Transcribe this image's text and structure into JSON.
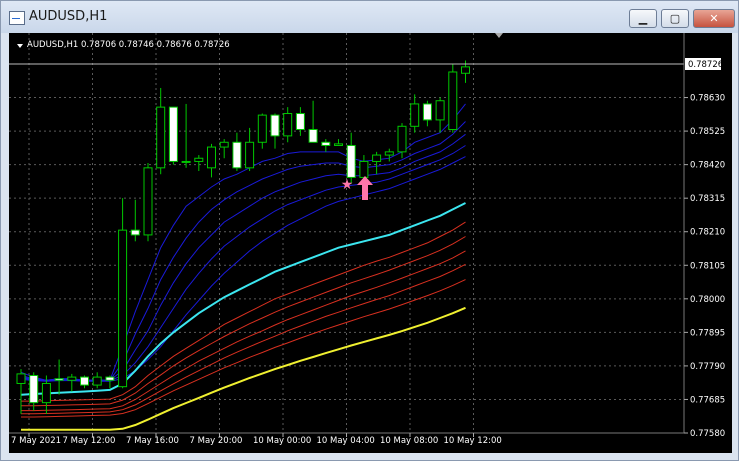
{
  "window": {
    "title": "AUDUSD,H1"
  },
  "controls": {
    "minimize": "▁",
    "maximize": "▢",
    "close": "✕"
  },
  "symbol_info": "AUDUSD,H1  0.78706 0.78746 0.78676 0.78726",
  "current_price": "0.78726",
  "colors": {
    "background": "#000000",
    "grid": "#5a5a5a",
    "candle_up": "#ffffff",
    "candle_down": "#000000",
    "candle_outline": "#00c800",
    "blue_ma": "#1a1ad8",
    "cyan_ma": "#3ce6f0",
    "red_ma": "#d83020",
    "yellow_ma": "#f0f030",
    "arrow": "#ff77aa",
    "star": "#ff77aa"
  },
  "chart_data": {
    "type": "candlestick",
    "ylim": [
      0.7758,
      0.78735
    ],
    "y_ticks": [
      "0.78630",
      "0.78525",
      "0.78420",
      "0.78315",
      "0.78210",
      "0.78105",
      "0.78000",
      "0.77895",
      "0.77790",
      "0.77685",
      "0.77580"
    ],
    "x_labels": [
      "7 May 2021",
      "7 May 12:00",
      "7 May 16:00",
      "7 May 20:00",
      "10 May 00:00",
      "10 May 04:00",
      "10 May 08:00",
      "10 May 12:00"
    ],
    "candles": [
      {
        "o": 0.77735,
        "h": 0.7778,
        "l": 0.7764,
        "c": 0.77765
      },
      {
        "o": 0.7776,
        "h": 0.7777,
        "l": 0.7765,
        "c": 0.77675
      },
      {
        "o": 0.77675,
        "h": 0.7776,
        "l": 0.7764,
        "c": 0.77735
      },
      {
        "o": 0.7775,
        "h": 0.7781,
        "l": 0.777,
        "c": 0.77745
      },
      {
        "o": 0.77745,
        "h": 0.77765,
        "l": 0.7771,
        "c": 0.77755
      },
      {
        "o": 0.77755,
        "h": 0.7776,
        "l": 0.7772,
        "c": 0.7773
      },
      {
        "o": 0.7773,
        "h": 0.7777,
        "l": 0.7772,
        "c": 0.77755
      },
      {
        "o": 0.77755,
        "h": 0.7776,
        "l": 0.7772,
        "c": 0.77745
      },
      {
        "o": 0.77725,
        "h": 0.78315,
        "l": 0.7772,
        "c": 0.78215
      },
      {
        "o": 0.78215,
        "h": 0.7831,
        "l": 0.7818,
        "c": 0.782
      },
      {
        "o": 0.782,
        "h": 0.78425,
        "l": 0.7818,
        "c": 0.7841
      },
      {
        "o": 0.7841,
        "h": 0.7866,
        "l": 0.7839,
        "c": 0.786
      },
      {
        "o": 0.786,
        "h": 0.786,
        "l": 0.7842,
        "c": 0.7843
      },
      {
        "o": 0.7843,
        "h": 0.7861,
        "l": 0.7841,
        "c": 0.7843
      },
      {
        "o": 0.7843,
        "h": 0.7845,
        "l": 0.784,
        "c": 0.7844
      },
      {
        "o": 0.7841,
        "h": 0.78485,
        "l": 0.7838,
        "c": 0.78475
      },
      {
        "o": 0.78475,
        "h": 0.785,
        "l": 0.7844,
        "c": 0.7849
      },
      {
        "o": 0.7849,
        "h": 0.7852,
        "l": 0.784,
        "c": 0.7841
      },
      {
        "o": 0.7841,
        "h": 0.78535,
        "l": 0.784,
        "c": 0.7849
      },
      {
        "o": 0.7849,
        "h": 0.7858,
        "l": 0.7847,
        "c": 0.78575
      },
      {
        "o": 0.78575,
        "h": 0.7858,
        "l": 0.7847,
        "c": 0.7851
      },
      {
        "o": 0.7851,
        "h": 0.786,
        "l": 0.7849,
        "c": 0.7858
      },
      {
        "o": 0.7858,
        "h": 0.786,
        "l": 0.7851,
        "c": 0.7853
      },
      {
        "o": 0.7853,
        "h": 0.7862,
        "l": 0.7849,
        "c": 0.7849
      },
      {
        "o": 0.7849,
        "h": 0.785,
        "l": 0.7846,
        "c": 0.7848
      },
      {
        "o": 0.7848,
        "h": 0.785,
        "l": 0.7848,
        "c": 0.78485
      },
      {
        "o": 0.7848,
        "h": 0.7852,
        "l": 0.7836,
        "c": 0.7838
      },
      {
        "o": 0.7838,
        "h": 0.7845,
        "l": 0.7837,
        "c": 0.7843
      },
      {
        "o": 0.7843,
        "h": 0.7846,
        "l": 0.7839,
        "c": 0.7845
      },
      {
        "o": 0.7845,
        "h": 0.7847,
        "l": 0.7843,
        "c": 0.7846
      },
      {
        "o": 0.7846,
        "h": 0.7855,
        "l": 0.7844,
        "c": 0.7854
      },
      {
        "o": 0.7854,
        "h": 0.7864,
        "l": 0.7852,
        "c": 0.7861
      },
      {
        "o": 0.7861,
        "h": 0.7862,
        "l": 0.7854,
        "c": 0.7856
      },
      {
        "o": 0.7856,
        "h": 0.7863,
        "l": 0.7852,
        "c": 0.7862
      },
      {
        "o": 0.7853,
        "h": 0.78735,
        "l": 0.7852,
        "c": 0.7871
      },
      {
        "o": 0.78706,
        "h": 0.78746,
        "l": 0.78676,
        "c": 0.78726
      }
    ],
    "ma_series": [
      {
        "color": "blue",
        "values": [
          0.7777,
          0.77755,
          0.77745,
          0.7775,
          0.7775,
          0.77745,
          0.77745,
          0.77745,
          0.7785,
          0.7796,
          0.7806,
          0.7816,
          0.7823,
          0.7829,
          0.7832,
          0.7835,
          0.78375,
          0.7839,
          0.7841,
          0.7843,
          0.7844,
          0.78455,
          0.7846,
          0.7846,
          0.7846,
          0.7846,
          0.7844,
          0.7843,
          0.78435,
          0.7844,
          0.7846,
          0.7849,
          0.78505,
          0.7852,
          0.7856,
          0.7861
        ]
      },
      {
        "color": "blue",
        "values": [
          0.7776,
          0.7775,
          0.77745,
          0.7775,
          0.7775,
          0.77745,
          0.77745,
          0.77745,
          0.778,
          0.7789,
          0.7797,
          0.7806,
          0.7813,
          0.7819,
          0.7824,
          0.7828,
          0.7831,
          0.78335,
          0.78355,
          0.78375,
          0.7839,
          0.78405,
          0.78415,
          0.7842,
          0.78425,
          0.78425,
          0.78415,
          0.7841,
          0.78415,
          0.7842,
          0.78435,
          0.78455,
          0.7847,
          0.78485,
          0.78515,
          0.78555
        ]
      },
      {
        "color": "blue",
        "values": [
          0.77755,
          0.77748,
          0.77745,
          0.77748,
          0.77748,
          0.77745,
          0.77745,
          0.77745,
          0.77775,
          0.7784,
          0.779,
          0.7798,
          0.7805,
          0.7811,
          0.7816,
          0.782,
          0.7824,
          0.78265,
          0.7829,
          0.78315,
          0.78335,
          0.7835,
          0.78365,
          0.78375,
          0.78385,
          0.7839,
          0.78385,
          0.78385,
          0.7839,
          0.78395,
          0.7841,
          0.7843,
          0.78445,
          0.7846,
          0.78485,
          0.78515
        ]
      },
      {
        "color": "blue",
        "values": [
          0.77752,
          0.77746,
          0.77744,
          0.77746,
          0.77746,
          0.77744,
          0.77744,
          0.77744,
          0.7776,
          0.778,
          0.7785,
          0.7791,
          0.7797,
          0.7803,
          0.7808,
          0.78125,
          0.78165,
          0.78195,
          0.78225,
          0.7825,
          0.78275,
          0.78295,
          0.7831,
          0.78325,
          0.7834,
          0.7835,
          0.78355,
          0.7836,
          0.78365,
          0.78375,
          0.7839,
          0.78405,
          0.7842,
          0.78435,
          0.78455,
          0.7848
        ]
      },
      {
        "color": "blue",
        "values": [
          0.77748,
          0.77744,
          0.77742,
          0.77744,
          0.77744,
          0.77742,
          0.77742,
          0.77742,
          0.7775,
          0.77775,
          0.7781,
          0.7785,
          0.779,
          0.7795,
          0.77995,
          0.7804,
          0.7808,
          0.78115,
          0.7815,
          0.7818,
          0.78205,
          0.7823,
          0.7825,
          0.7827,
          0.7829,
          0.78305,
          0.78315,
          0.78325,
          0.78335,
          0.78345,
          0.7836,
          0.78375,
          0.7839,
          0.78405,
          0.78425,
          0.78445
        ]
      },
      {
        "color": "cyan",
        "values": [
          0.777,
          0.77702,
          0.77704,
          0.77706,
          0.77708,
          0.7771,
          0.77712,
          0.77715,
          0.77735,
          0.77775,
          0.7782,
          0.7786,
          0.77895,
          0.77925,
          0.77955,
          0.7798,
          0.78005,
          0.78025,
          0.78045,
          0.78065,
          0.78085,
          0.781,
          0.78115,
          0.7813,
          0.78145,
          0.7816,
          0.7817,
          0.7818,
          0.7819,
          0.782,
          0.78215,
          0.7823,
          0.78245,
          0.7826,
          0.7828,
          0.783
        ]
      },
      {
        "color": "red",
        "values": [
          0.7768,
          0.7768,
          0.77681,
          0.77682,
          0.77683,
          0.77684,
          0.77685,
          0.77686,
          0.777,
          0.77725,
          0.7776,
          0.7779,
          0.7782,
          0.77845,
          0.7787,
          0.77895,
          0.7792,
          0.7794,
          0.7796,
          0.7798,
          0.78,
          0.78015,
          0.7803,
          0.78045,
          0.7806,
          0.78075,
          0.7809,
          0.78105,
          0.78118,
          0.7813,
          0.78145,
          0.7816,
          0.78175,
          0.78195,
          0.78215,
          0.7824
        ]
      },
      {
        "color": "red",
        "values": [
          0.77665,
          0.77665,
          0.77666,
          0.77667,
          0.77668,
          0.77669,
          0.7767,
          0.77671,
          0.77683,
          0.77705,
          0.77735,
          0.77762,
          0.7779,
          0.77815,
          0.77838,
          0.7786,
          0.77882,
          0.77902,
          0.77922,
          0.7794,
          0.77958,
          0.77975,
          0.7799,
          0.78005,
          0.7802,
          0.78035,
          0.7805,
          0.78063,
          0.78076,
          0.7809,
          0.78105,
          0.7812,
          0.78135,
          0.78152,
          0.78172,
          0.78195
        ]
      },
      {
        "color": "red",
        "values": [
          0.7765,
          0.7765,
          0.77651,
          0.77652,
          0.77653,
          0.77654,
          0.77655,
          0.77656,
          0.77665,
          0.77685,
          0.7771,
          0.77735,
          0.7776,
          0.77782,
          0.77805,
          0.77825,
          0.77845,
          0.77865,
          0.77883,
          0.779,
          0.77918,
          0.77935,
          0.7795,
          0.77965,
          0.7798,
          0.77995,
          0.7801,
          0.78023,
          0.78036,
          0.7805,
          0.78065,
          0.7808,
          0.78095,
          0.7811,
          0.78128,
          0.7815
        ]
      },
      {
        "color": "red",
        "values": [
          0.7764,
          0.7764,
          0.77641,
          0.77642,
          0.77643,
          0.77644,
          0.77645,
          0.77646,
          0.77653,
          0.77668,
          0.7769,
          0.77712,
          0.77734,
          0.77755,
          0.77775,
          0.77795,
          0.77815,
          0.77833,
          0.7785,
          0.77867,
          0.77883,
          0.779,
          0.77915,
          0.7793,
          0.77945,
          0.77958,
          0.77972,
          0.77985,
          0.77998,
          0.7801,
          0.78025,
          0.7804,
          0.78055,
          0.7807,
          0.78088,
          0.78108
        ]
      },
      {
        "color": "red",
        "values": [
          0.7763,
          0.7763,
          0.77631,
          0.77632,
          0.77633,
          0.77634,
          0.77635,
          0.77636,
          0.77641,
          0.77653,
          0.77672,
          0.77692,
          0.77712,
          0.7773,
          0.77748,
          0.77766,
          0.77784,
          0.778,
          0.77817,
          0.77832,
          0.77848,
          0.77862,
          0.77877,
          0.77891,
          0.77905,
          0.77918,
          0.77931,
          0.77944,
          0.77956,
          0.77968,
          0.77982,
          0.77996,
          0.7801,
          0.78025,
          0.78042,
          0.7806
        ]
      },
      {
        "color": "yellow",
        "values": [
          0.7759,
          0.7759,
          0.7759,
          0.7759,
          0.7759,
          0.7759,
          0.7759,
          0.7759,
          0.77593,
          0.77605,
          0.77622,
          0.7764,
          0.77658,
          0.77674,
          0.7769,
          0.77706,
          0.77722,
          0.77737,
          0.77752,
          0.77766,
          0.7778,
          0.77793,
          0.77806,
          0.77818,
          0.7783,
          0.77842,
          0.77854,
          0.77865,
          0.77876,
          0.77887,
          0.77899,
          0.77912,
          0.77925,
          0.7794,
          0.77955,
          0.77972
        ]
      }
    ]
  }
}
